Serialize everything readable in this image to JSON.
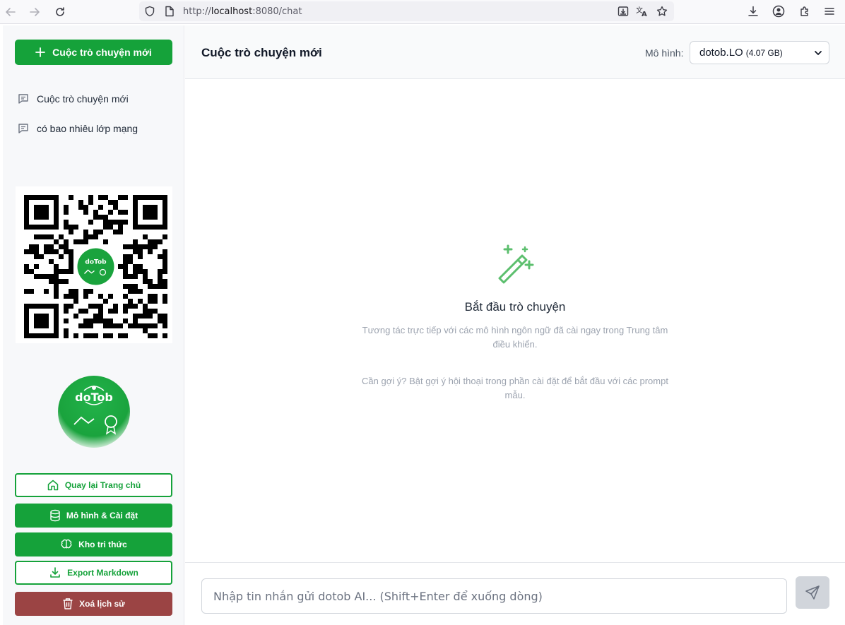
{
  "browser": {
    "url_prefix": "http://",
    "url_host": "localhost",
    "url_rest": ":8080/chat"
  },
  "sidebar": {
    "new_chat_label": "Cuộc trò chuyện mới",
    "conversations": [
      {
        "label": "Cuộc trò chuyện mới"
      },
      {
        "label": "có bao nhiêu lớp mạng"
      }
    ],
    "logo_text": "doTob",
    "buttons": {
      "home": "Quay lại Trang chủ",
      "models": "Mô hình & Cài đặt",
      "knowledge": "Kho tri thức",
      "export": "Export Markdown",
      "clear": "Xoá lịch sử"
    }
  },
  "header": {
    "title": "Cuộc trò chuyện mới",
    "model_label": "Mô hình:",
    "model_name": "dotob.LO",
    "model_size": "(4.07 GB)"
  },
  "empty_state": {
    "title": "Bắt đầu trò chuyện",
    "description": "Tương tác trực tiếp với các mô hình ngôn ngữ đã cài ngay trong Trung tâm điều khiển.",
    "hint": "Cần gợi ý? Bật gợi ý hội thoại trong phần cài đặt để bắt đầu với các prompt mẫu."
  },
  "composer": {
    "placeholder": "Nhập tin nhắn gửi dotob AI... (Shift+Enter để xuống dòng)"
  },
  "colors": {
    "accent": "#15a23a",
    "danger": "#9b4444"
  }
}
